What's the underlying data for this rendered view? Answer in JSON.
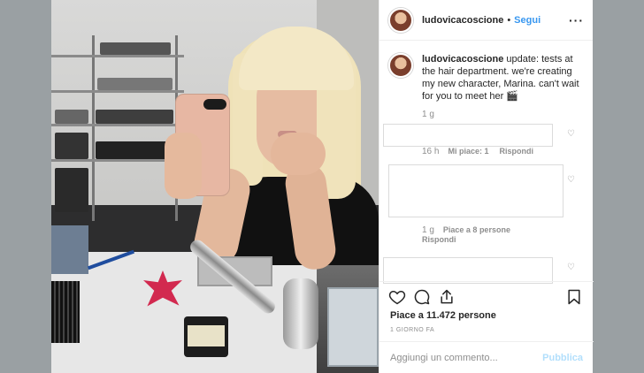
{
  "post": {
    "username": "ludovicacoscione",
    "separator": "•",
    "follow_label": "Segui",
    "more_label": "···",
    "caption": {
      "username": "ludovicacoscione",
      "text": " update: tests at the hair department. we're creating my new character, Marina. can't wait for you to meet her 🎬",
      "time": "1 g"
    },
    "comments": [
      {
        "time": "16 h",
        "likes": "Mi piace: 1",
        "reply": "Rispondi"
      },
      {
        "time": "1 g",
        "likes": "Piace a 8 persone",
        "reply": "Rispondi"
      }
    ],
    "likes_text": "Piace a 11.472 persone",
    "time_ago": "1 GIORNO FA",
    "comment_placeholder": "Aggiungi un commento...",
    "publish_label": "Pubblica"
  },
  "icons": {
    "like": "heart-icon",
    "comment": "comment-icon",
    "share": "share-icon",
    "save": "bookmark-icon",
    "more": "more-options-icon"
  },
  "colors": {
    "link_blue": "#3897f0",
    "publish_disabled": "#b2dffc",
    "muted_text": "#8e8e8e",
    "border": "#dbdbdb"
  }
}
